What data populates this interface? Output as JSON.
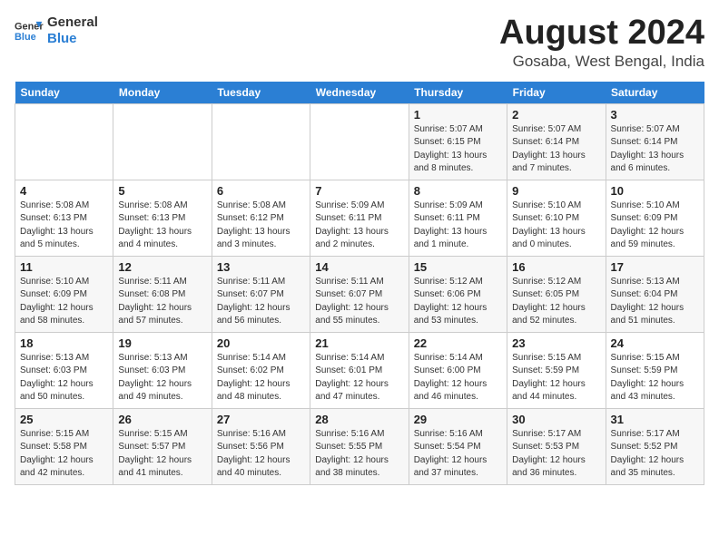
{
  "header": {
    "logo_line1": "General",
    "logo_line2": "Blue",
    "month": "August 2024",
    "location": "Gosaba, West Bengal, India"
  },
  "days_of_week": [
    "Sunday",
    "Monday",
    "Tuesday",
    "Wednesday",
    "Thursday",
    "Friday",
    "Saturday"
  ],
  "weeks": [
    [
      {
        "num": "",
        "info": ""
      },
      {
        "num": "",
        "info": ""
      },
      {
        "num": "",
        "info": ""
      },
      {
        "num": "",
        "info": ""
      },
      {
        "num": "1",
        "info": "Sunrise: 5:07 AM\nSunset: 6:15 PM\nDaylight: 13 hours\nand 8 minutes."
      },
      {
        "num": "2",
        "info": "Sunrise: 5:07 AM\nSunset: 6:14 PM\nDaylight: 13 hours\nand 7 minutes."
      },
      {
        "num": "3",
        "info": "Sunrise: 5:07 AM\nSunset: 6:14 PM\nDaylight: 13 hours\nand 6 minutes."
      }
    ],
    [
      {
        "num": "4",
        "info": "Sunrise: 5:08 AM\nSunset: 6:13 PM\nDaylight: 13 hours\nand 5 minutes."
      },
      {
        "num": "5",
        "info": "Sunrise: 5:08 AM\nSunset: 6:13 PM\nDaylight: 13 hours\nand 4 minutes."
      },
      {
        "num": "6",
        "info": "Sunrise: 5:08 AM\nSunset: 6:12 PM\nDaylight: 13 hours\nand 3 minutes."
      },
      {
        "num": "7",
        "info": "Sunrise: 5:09 AM\nSunset: 6:11 PM\nDaylight: 13 hours\nand 2 minutes."
      },
      {
        "num": "8",
        "info": "Sunrise: 5:09 AM\nSunset: 6:11 PM\nDaylight: 13 hours\nand 1 minute."
      },
      {
        "num": "9",
        "info": "Sunrise: 5:10 AM\nSunset: 6:10 PM\nDaylight: 13 hours\nand 0 minutes."
      },
      {
        "num": "10",
        "info": "Sunrise: 5:10 AM\nSunset: 6:09 PM\nDaylight: 12 hours\nand 59 minutes."
      }
    ],
    [
      {
        "num": "11",
        "info": "Sunrise: 5:10 AM\nSunset: 6:09 PM\nDaylight: 12 hours\nand 58 minutes."
      },
      {
        "num": "12",
        "info": "Sunrise: 5:11 AM\nSunset: 6:08 PM\nDaylight: 12 hours\nand 57 minutes."
      },
      {
        "num": "13",
        "info": "Sunrise: 5:11 AM\nSunset: 6:07 PM\nDaylight: 12 hours\nand 56 minutes."
      },
      {
        "num": "14",
        "info": "Sunrise: 5:11 AM\nSunset: 6:07 PM\nDaylight: 12 hours\nand 55 minutes."
      },
      {
        "num": "15",
        "info": "Sunrise: 5:12 AM\nSunset: 6:06 PM\nDaylight: 12 hours\nand 53 minutes."
      },
      {
        "num": "16",
        "info": "Sunrise: 5:12 AM\nSunset: 6:05 PM\nDaylight: 12 hours\nand 52 minutes."
      },
      {
        "num": "17",
        "info": "Sunrise: 5:13 AM\nSunset: 6:04 PM\nDaylight: 12 hours\nand 51 minutes."
      }
    ],
    [
      {
        "num": "18",
        "info": "Sunrise: 5:13 AM\nSunset: 6:03 PM\nDaylight: 12 hours\nand 50 minutes."
      },
      {
        "num": "19",
        "info": "Sunrise: 5:13 AM\nSunset: 6:03 PM\nDaylight: 12 hours\nand 49 minutes."
      },
      {
        "num": "20",
        "info": "Sunrise: 5:14 AM\nSunset: 6:02 PM\nDaylight: 12 hours\nand 48 minutes."
      },
      {
        "num": "21",
        "info": "Sunrise: 5:14 AM\nSunset: 6:01 PM\nDaylight: 12 hours\nand 47 minutes."
      },
      {
        "num": "22",
        "info": "Sunrise: 5:14 AM\nSunset: 6:00 PM\nDaylight: 12 hours\nand 46 minutes."
      },
      {
        "num": "23",
        "info": "Sunrise: 5:15 AM\nSunset: 5:59 PM\nDaylight: 12 hours\nand 44 minutes."
      },
      {
        "num": "24",
        "info": "Sunrise: 5:15 AM\nSunset: 5:59 PM\nDaylight: 12 hours\nand 43 minutes."
      }
    ],
    [
      {
        "num": "25",
        "info": "Sunrise: 5:15 AM\nSunset: 5:58 PM\nDaylight: 12 hours\nand 42 minutes."
      },
      {
        "num": "26",
        "info": "Sunrise: 5:15 AM\nSunset: 5:57 PM\nDaylight: 12 hours\nand 41 minutes."
      },
      {
        "num": "27",
        "info": "Sunrise: 5:16 AM\nSunset: 5:56 PM\nDaylight: 12 hours\nand 40 minutes."
      },
      {
        "num": "28",
        "info": "Sunrise: 5:16 AM\nSunset: 5:55 PM\nDaylight: 12 hours\nand 38 minutes."
      },
      {
        "num": "29",
        "info": "Sunrise: 5:16 AM\nSunset: 5:54 PM\nDaylight: 12 hours\nand 37 minutes."
      },
      {
        "num": "30",
        "info": "Sunrise: 5:17 AM\nSunset: 5:53 PM\nDaylight: 12 hours\nand 36 minutes."
      },
      {
        "num": "31",
        "info": "Sunrise: 5:17 AM\nSunset: 5:52 PM\nDaylight: 12 hours\nand 35 minutes."
      }
    ]
  ]
}
